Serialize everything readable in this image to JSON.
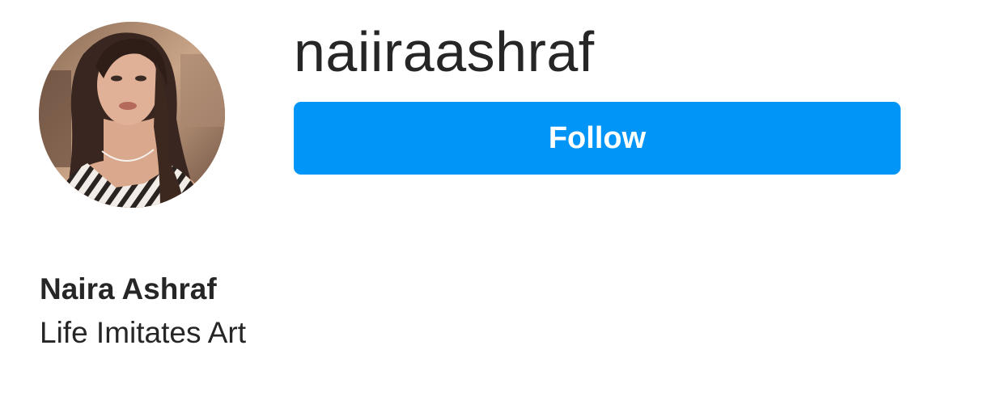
{
  "profile": {
    "username": "naiiraashraf",
    "display_name": "Naira Ashraf",
    "bio": "Life Imitates Art",
    "avatar_icon": "profile-photo"
  },
  "actions": {
    "follow_label": "Follow"
  },
  "colors": {
    "accent": "#0095f6",
    "text": "#262626",
    "background": "#ffffff"
  }
}
